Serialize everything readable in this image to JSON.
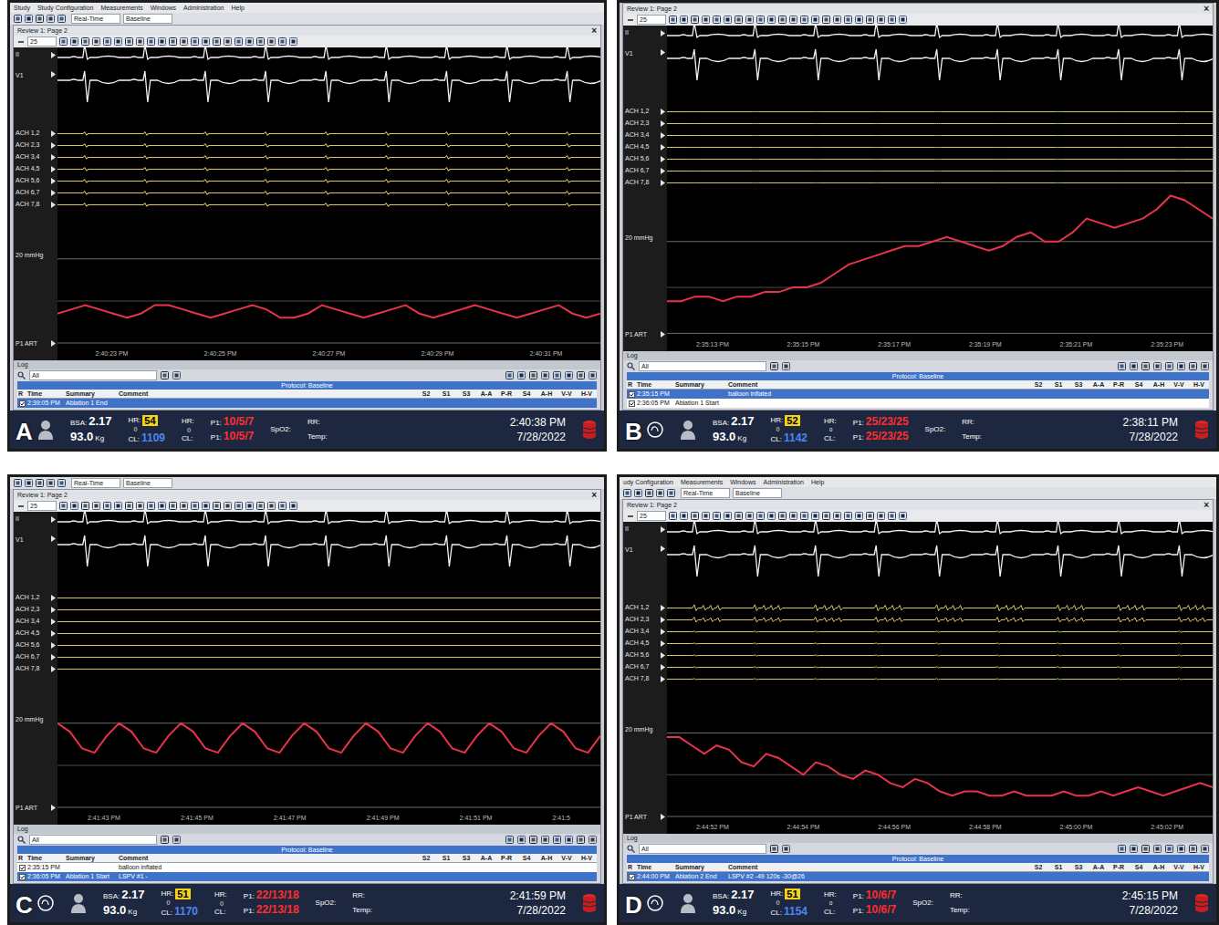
{
  "panels": [
    {
      "label": "A",
      "menu": [
        "Study",
        "Study Configuration",
        "Measurements",
        "Windows",
        "Administration",
        "Help"
      ],
      "toolbar": {
        "mode": "Real-Time",
        "protocol": "Baseline"
      },
      "window": {
        "title": "Review 1: Page 2",
        "close": "×"
      },
      "zoom": "25",
      "leads": [
        "II",
        "V1"
      ],
      "beats": 9,
      "channels": [
        {
          "name": "ACH 1,2",
          "amplitude": 0.3
        },
        {
          "name": "ACH 2,3",
          "amplitude": 0.3
        },
        {
          "name": "ACH 3,4",
          "amplitude": 0.3
        },
        {
          "name": "ACH 4,5",
          "amplitude": 0.3
        },
        {
          "name": "ACH 5,6",
          "amplitude": 0.3
        },
        {
          "name": "ACH 6,7",
          "amplitude": 0.3
        },
        {
          "name": "ACH 7,8",
          "amplitude": 0.3
        }
      ],
      "pressure": {
        "scale_label": "20 mmHg",
        "name": "P1 ART",
        "values": [
          7,
          8,
          9,
          8,
          7,
          6,
          7,
          9,
          9,
          8,
          7,
          6,
          7,
          8,
          9,
          8,
          6,
          6,
          7,
          9,
          8,
          7,
          6,
          7,
          8,
          9,
          7,
          6,
          7,
          8,
          9,
          8,
          7,
          6,
          7,
          8,
          9,
          7,
          6,
          7
        ]
      },
      "ticks": [
        "2:40:23 PM",
        "2:40:25 PM",
        "2:40:27 PM",
        "2:40:29 PM",
        "2:40:31 PM"
      ],
      "log": {
        "title": "Log",
        "filter": "All",
        "protocol": "Protocol: Baseline",
        "columns_left": [
          "R",
          "Time",
          "Summary",
          "Comment"
        ],
        "columns_right": [
          "S2",
          "S1",
          "S3",
          "A-A",
          "P-R",
          "S4",
          "A-H",
          "V-V",
          "H-V"
        ],
        "rows": [
          {
            "checked": true,
            "time": "2:39:05 PM",
            "summary": "Ablation 1 End",
            "comment": "",
            "selected": true
          }
        ]
      },
      "status": {
        "logo": false,
        "bsa_label": "BSA:",
        "bsa": "2.17",
        "weight": "93.0",
        "weight_unit": "Kg",
        "hr_label": "HR:",
        "hr": "54",
        "hr_sub": "()",
        "cl_label": "CL:",
        "cl": "1109",
        "hr2_label": "HR:",
        "hr2_sub": "()",
        "cl2_label": "CL:",
        "p1_label": "P1:",
        "p1": [
          "10/5/7",
          "10/5/7"
        ],
        "spo2": "SpO2:",
        "rr": "RR:",
        "temp": "Temp:",
        "time": "2:40:38 PM",
        "date": "7/28/2022"
      }
    },
    {
      "label": "B",
      "menu": [],
      "toolbar": null,
      "window": {
        "title": "Review 1: Page 2",
        "close": "×"
      },
      "zoom": "25",
      "leads": [
        "II",
        "V1"
      ],
      "beats": 9,
      "channels": [
        {
          "name": "ACH 1,2",
          "amplitude": 0
        },
        {
          "name": "ACH 2,3",
          "amplitude": 0
        },
        {
          "name": "ACH 3,4",
          "amplitude": 0
        },
        {
          "name": "ACH 4,5",
          "amplitude": 0
        },
        {
          "name": "ACH 5,6",
          "amplitude": 0
        },
        {
          "name": "ACH 6,7",
          "amplitude": 0
        },
        {
          "name": "ACH 7,8",
          "amplitude": 0
        }
      ],
      "pressure": {
        "scale_label": "20 mmHg",
        "name": "P1 ART",
        "values": [
          7,
          7,
          8,
          8,
          7,
          8,
          8,
          9,
          9,
          10,
          10,
          11,
          13,
          15,
          16,
          17,
          18,
          19,
          19,
          20,
          21,
          20,
          19,
          18,
          19,
          21,
          22,
          20,
          20,
          22,
          25,
          24,
          23,
          24,
          25,
          27,
          30,
          29,
          27,
          25
        ]
      },
      "ticks": [
        "2:35:13 PM",
        "2:35:15 PM",
        "2:35:17 PM",
        "2:35:19 PM",
        "2:35:21 PM",
        "2:35:23 PM"
      ],
      "log": {
        "title": "Log",
        "filter": "All",
        "protocol": "Protocol: Baseline",
        "columns_left": [
          "R",
          "Time",
          "Summary",
          "Comment"
        ],
        "columns_right": [
          "S2",
          "S1",
          "S3",
          "A-A",
          "P-R",
          "S4",
          "A-H",
          "V-V",
          "H-V"
        ],
        "rows": [
          {
            "checked": true,
            "time": "2:35:15 PM",
            "summary": "",
            "comment": "balloon inflated",
            "selected": true
          },
          {
            "checked": true,
            "time": "2:36:05 PM",
            "summary": "Ablation 1 Start",
            "comment": "",
            "selected": false
          }
        ]
      },
      "status": {
        "logo": true,
        "bsa_label": "BSA:",
        "bsa": "2.17",
        "weight": "93.0",
        "weight_unit": "Kg",
        "hr_label": "HR:",
        "hr": "52",
        "hr_sub": "()",
        "cl_label": "CL:",
        "cl": "1142",
        "hr2_label": "HR:",
        "hr2_sub": "0",
        "cl2_label": "CL:",
        "p1_label": "P1:",
        "p1": [
          "25/23/25",
          "25/23/25"
        ],
        "spo2": "SpO2:",
        "rr": "RR:",
        "temp": "Temp:",
        "time": "2:38:11 PM",
        "date": "7/28/2022"
      }
    },
    {
      "label": "C",
      "menu": [],
      "toolbar": {
        "mode": "Real-Time",
        "protocol": "Baseline"
      },
      "window": {
        "title": "Review 1: Page 2",
        "close": "×"
      },
      "zoom": "25",
      "leads": [
        "II",
        "V1"
      ],
      "beats": 9,
      "channels": [
        {
          "name": "ACH 1,2",
          "amplitude": 0
        },
        {
          "name": "ACH 2,3",
          "amplitude": 0
        },
        {
          "name": "ACH 3,4",
          "amplitude": 0
        },
        {
          "name": "ACH 4,5",
          "amplitude": 0
        },
        {
          "name": "ACH 5,6",
          "amplitude": 0
        },
        {
          "name": "ACH 6,7",
          "amplitude": 0
        },
        {
          "name": "ACH 7,8",
          "amplitude": 0
        }
      ],
      "pressure": {
        "scale_label": "20 mmHg",
        "name": "P1 ART",
        "values": [
          20,
          18,
          14,
          13,
          17,
          20,
          18,
          14,
          13,
          17,
          20,
          18,
          14,
          13,
          17,
          20,
          18,
          14,
          13,
          17,
          20,
          18,
          14,
          13,
          17,
          20,
          18,
          14,
          13,
          17,
          20,
          18,
          14,
          13,
          17,
          20,
          18,
          14,
          13,
          17,
          20,
          18,
          14,
          13,
          17
        ]
      },
      "ticks": [
        "2:41:43 PM",
        "2:41:45 PM",
        "2:41:47 PM",
        "2:41:49 PM",
        "2:41:51 PM",
        "2:41:5"
      ],
      "log": {
        "title": "Log",
        "filter": "All",
        "protocol": "Protocol: Baseline",
        "columns_left": [
          "R",
          "Time",
          "Summary",
          "Comment"
        ],
        "columns_right": [
          "S2",
          "S1",
          "S3",
          "A-A",
          "P-R",
          "S4",
          "A-H",
          "V-V",
          "H-V"
        ],
        "rows": [
          {
            "checked": true,
            "time": "2:35:15 PM",
            "summary": "",
            "comment": "balloon inflated",
            "selected": false
          },
          {
            "checked": true,
            "time": "2:36:05 PM",
            "summary": "Ablation 1 Start",
            "comment": "LSPV #1 -",
            "selected": true
          }
        ]
      },
      "status": {
        "logo": true,
        "bsa_label": "BSA:",
        "bsa": "2.17",
        "weight": "93.0",
        "weight_unit": "Kg",
        "hr_label": "HR:",
        "hr": "51",
        "hr_sub": "()",
        "cl_label": "CL:",
        "cl": "1170",
        "hr2_label": "HR:",
        "hr2_sub": "()",
        "cl2_label": "CL:",
        "p1_label": "P1:",
        "p1": [
          "22/13/18",
          "22/13/18"
        ],
        "spo2": "SpO2:",
        "rr": "RR:",
        "temp": "Temp:",
        "time": "2:41:59 PM",
        "date": "7/28/2022"
      }
    },
    {
      "label": "D",
      "menu": [
        "udy Configuration",
        "Measurements",
        "Windows",
        "Administration",
        "Help"
      ],
      "toolbar": {
        "mode": "Real-Time",
        "protocol": "Baseline"
      },
      "window": {
        "title": "Review 1: Page 2",
        "close": "×"
      },
      "zoom": "25",
      "leads": [
        "II",
        "V1"
      ],
      "beats": 9,
      "channels": [
        {
          "name": "ACH 1,2",
          "amplitude": 0.6
        },
        {
          "name": "ACH 2,3",
          "amplitude": 0.5
        },
        {
          "name": "ACH 3,4",
          "amplitude": 0.1
        },
        {
          "name": "ACH 4,5",
          "amplitude": 0.1
        },
        {
          "name": "ACH 5,6",
          "amplitude": 0.1
        },
        {
          "name": "ACH 6,7",
          "amplitude": 0.1
        },
        {
          "name": "ACH 7,8",
          "amplitude": 0.1
        }
      ],
      "pressure": {
        "scale_label": "20 mmHg",
        "name": "P1 ART",
        "values": [
          19,
          19,
          17,
          15,
          17,
          16,
          13,
          12,
          15,
          14,
          12,
          10,
          13,
          12,
          10,
          9,
          11,
          10,
          8,
          7,
          9,
          8,
          6,
          5,
          6,
          6,
          5,
          5,
          6,
          5,
          5,
          5,
          6,
          5,
          5,
          6,
          5,
          6,
          7,
          6,
          5,
          6,
          7,
          8,
          7
        ]
      },
      "ticks": [
        "2:44:52 PM",
        "2:44:54 PM",
        "2:44:56 PM",
        "2:44:58 PM",
        "2:45:00 PM",
        "2:45:02 PM"
      ],
      "log": {
        "title": "Log",
        "filter": "All",
        "protocol": "Protocol: Baseline",
        "columns_left": [
          "R",
          "Time",
          "Summary",
          "Comment"
        ],
        "columns_right": [
          "S2",
          "S1",
          "S3",
          "A-A",
          "P-R",
          "S4",
          "A-H",
          "V-V",
          "H-V"
        ],
        "rows": [
          {
            "checked": true,
            "time": "2:44:00 PM",
            "summary": "Ablation 2 End",
            "comment": "LSPV #2  -49  120s  -30@26",
            "selected": true
          }
        ]
      },
      "status": {
        "logo": true,
        "bsa_label": "BSA:",
        "bsa": "2.17",
        "weight": "93.0",
        "weight_unit": "Kg",
        "hr_label": "HR:",
        "hr": "51",
        "hr_sub": "()",
        "cl_label": "CL:",
        "cl": "1154",
        "hr2_label": "HR:",
        "hr2_sub": "0",
        "cl2_label": "CL:",
        "p1_label": "P1:",
        "p1": [
          "10/6/7",
          "10/6/7"
        ],
        "spo2": "SpO2:",
        "rr": "RR:",
        "temp": "Temp:",
        "time": "2:45:15 PM",
        "date": "7/28/2022"
      }
    }
  ]
}
